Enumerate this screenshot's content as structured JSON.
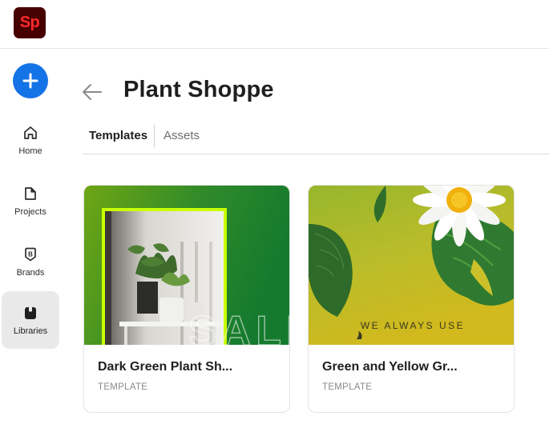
{
  "app": {
    "logo_text": "Sp",
    "logo_color": "#470000",
    "logo_text_color": "#ff2a2a"
  },
  "sidebar": {
    "create_icon": "plus-icon",
    "items": [
      {
        "label": "Home",
        "icon": "home-icon",
        "active": false
      },
      {
        "label": "Projects",
        "icon": "projects-icon",
        "active": false
      },
      {
        "label": "Brands",
        "icon": "brands-icon",
        "active": false
      },
      {
        "label": "Libraries",
        "icon": "libraries-icon",
        "active": true
      }
    ]
  },
  "page": {
    "title": "Plant Shoppe",
    "back_icon": "back-arrow-icon"
  },
  "tabs": [
    {
      "label": "Templates",
      "active": true
    },
    {
      "label": "Assets",
      "active": false
    }
  ],
  "cards": [
    {
      "title": "Dark Green Plant Sh...",
      "type": "TEMPLATE",
      "thumb_text": "SALE"
    },
    {
      "title": "Green and Yellow Gr...",
      "type": "TEMPLATE",
      "thumb_text": "WE ALWAYS USE"
    }
  ],
  "colors": {
    "accent": "#1473e6",
    "active_nav_bg": "#e9e9e9"
  }
}
